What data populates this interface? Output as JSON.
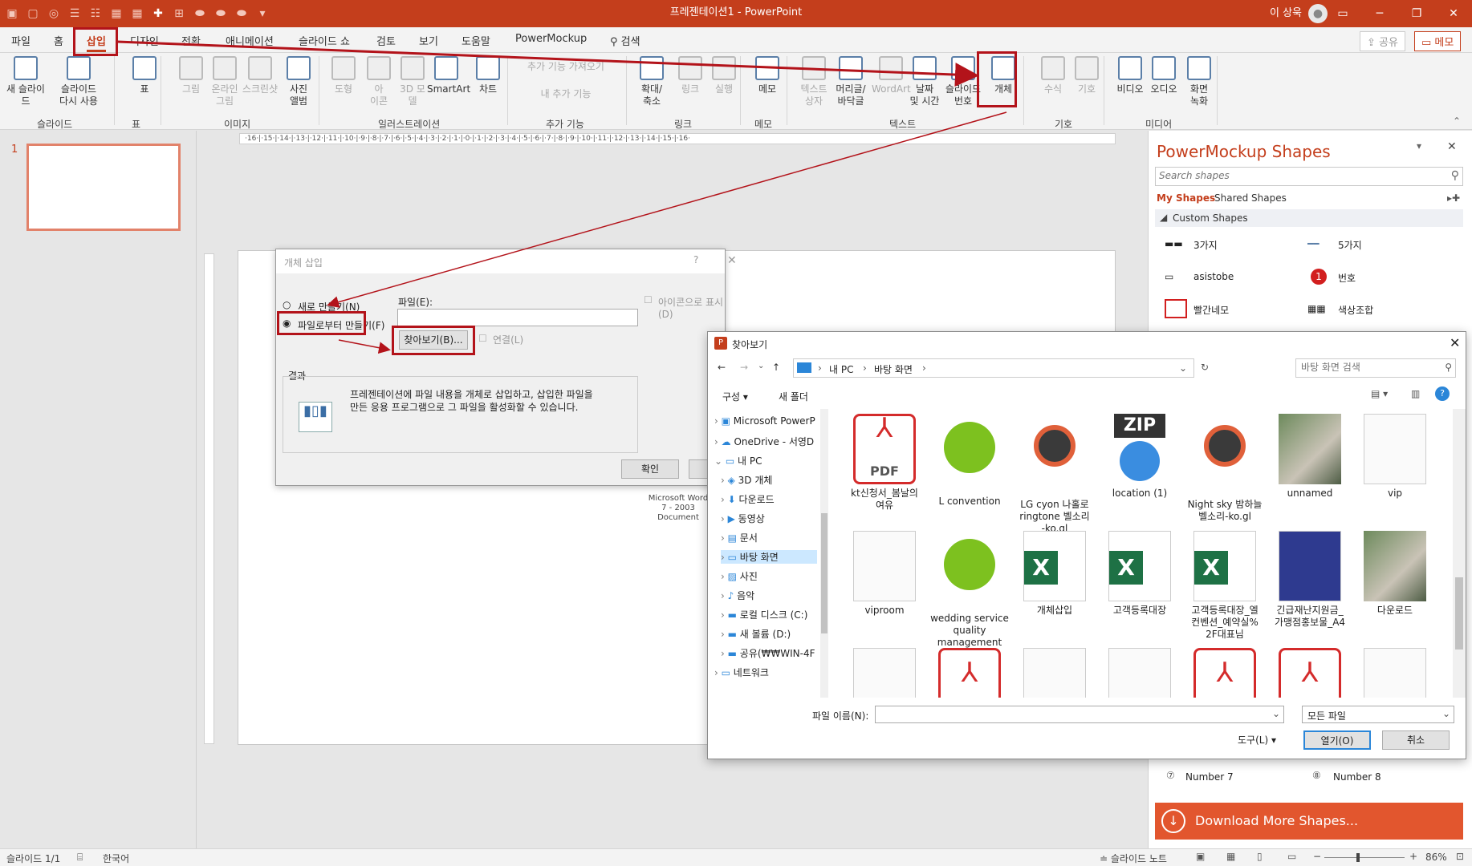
{
  "window": {
    "title": "프레젠테이션1  -  PowerPoint",
    "user": "이 상욱"
  },
  "tabs": [
    "파일",
    "홈",
    "삽입",
    "디자인",
    "전환",
    "애니메이션",
    "슬라이드 쇼",
    "검토",
    "보기",
    "도움말",
    "PowerMockup"
  ],
  "search_label": "검색",
  "share_label": "공유",
  "memo_label": "메모",
  "ribbon": {
    "buttons": [
      {
        "label": "새 슬라이드",
        "dim": false
      },
      {
        "label": "슬라이드\n다시 사용",
        "dim": false
      },
      {
        "label": "표",
        "dim": false
      },
      {
        "label": "그림",
        "dim": true
      },
      {
        "label": "온라인\n그림",
        "dim": true
      },
      {
        "label": "스크린샷",
        "dim": true
      },
      {
        "label": "사진\n앨범",
        "dim": false
      },
      {
        "label": "도형",
        "dim": true
      },
      {
        "label": "아\n이콘",
        "dim": true
      },
      {
        "label": "3D 모\n델",
        "dim": true
      },
      {
        "label": "SmartArt",
        "dim": false
      },
      {
        "label": "차트",
        "dim": false
      },
      {
        "label": "추가 기능 가져오기",
        "dim": true
      },
      {
        "label": "내 추가 기능",
        "dim": true
      },
      {
        "label": "확대/\n축소",
        "dim": false
      },
      {
        "label": "링크",
        "dim": true
      },
      {
        "label": "실행",
        "dim": true
      },
      {
        "label": "메모",
        "dim": false
      },
      {
        "label": "텍스트\n상자",
        "dim": true
      },
      {
        "label": "머리글/\n바닥글",
        "dim": false
      },
      {
        "label": "WordArt",
        "dim": true
      },
      {
        "label": "날짜\n및 시간",
        "dim": false
      },
      {
        "label": "슬라이드\n번호",
        "dim": false
      },
      {
        "label": "개체",
        "dim": false
      },
      {
        "label": "수식",
        "dim": true
      },
      {
        "label": "기호",
        "dim": true
      },
      {
        "label": "비디오",
        "dim": false
      },
      {
        "label": "오디오",
        "dim": false
      },
      {
        "label": "화면\n녹화",
        "dim": false
      }
    ],
    "groups": [
      "슬라이드",
      "표",
      "이미지",
      "일러스트레이션",
      "추가 기능",
      "링크",
      "메모",
      "텍스트",
      "기호",
      "미디어"
    ]
  },
  "slide_number": "1",
  "ruler_text": "·16·|·15·|·14·|·13·|·12·|·11·|·10·|·9·|·8·|·7·|·6·|·5·|·4·|·3·|·2·|·1·|·0·|·1·|·2·|·3·|·4·|·5·|·6·|·7·|·8·|·9·|·10·|·11·|·12·|·13·|·14·|·15·|·16·",
  "object_caption": [
    "Microsoft Word",
    "7 - 2003 Document"
  ],
  "insert_dialog": {
    "title": "개체 삽입",
    "help": "?",
    "create_new": "새로 만들기(N)",
    "create_from_file": "파일로부터 만들기(F)",
    "file_label": "파일(E):",
    "browse": "찾아보기(B)...",
    "link": "연결(L)",
    "display_icon": "아이콘으로 표시(D)",
    "result_label": "결과",
    "result_text": "프레젠테이션에 파일 내용을 개체로 삽입하고, 삽입한 파일을\n만든 응용 프로그램으로 그 파일을 활성화할 수 있습니다.",
    "ok": "확인"
  },
  "browse_dialog": {
    "title": "찾아보기",
    "path": [
      "내 PC",
      "바탕 화면"
    ],
    "search_placeholder": "바탕 화면 검색",
    "organize": "구성",
    "new_folder": "새 폴더",
    "tree": [
      "Microsoft PowerP",
      "OneDrive - 서영D",
      "내 PC",
      "3D 개체",
      "다운로드",
      "동영상",
      "문서",
      "바탕 화면",
      "사진",
      "음악",
      "로컬 디스크 (C:)",
      "새 볼륨 (D:)",
      "공유(₩₩WIN-4F",
      "네트워크"
    ],
    "files": [
      {
        "name": "kt신청서_봄날의\n여유",
        "kind": "pdf"
      },
      {
        "name": "L convention",
        "kind": "green"
      },
      {
        "name": "LG cyon 나홀로\nringtone 벨소리\n-ko.gl",
        "kind": "disc"
      },
      {
        "name": "location (1)",
        "kind": "zip"
      },
      {
        "name": "Night sky 밤하늘\n벨소리-ko.gl",
        "kind": "disc"
      },
      {
        "name": "unnamed",
        "kind": "photo"
      },
      {
        "name": "vip",
        "kind": "doc"
      },
      {
        "name": "viproom",
        "kind": "doc"
      },
      {
        "name": "wedding service\nquality\nmanagement",
        "kind": "green"
      },
      {
        "name": "개체삽입",
        "kind": "xls"
      },
      {
        "name": "고객등록대장",
        "kind": "xls"
      },
      {
        "name": "고객등록대장_엘\n컨벤션_예약실%\n2F대표님",
        "kind": "xls"
      },
      {
        "name": "긴급재난지원금_\n가맹점홍보물_A4",
        "kind": "poster"
      },
      {
        "name": "다운로드",
        "kind": "photo"
      }
    ],
    "filename_label": "파일 이름(N):",
    "filter": "모든 파일",
    "tools": "도구(L)",
    "open": "열기(O)",
    "cancel": "취소"
  },
  "panel": {
    "title": "PowerMockup Shapes",
    "search_placeholder": "Search shapes",
    "my_shapes": "My Shapes",
    "shared_shapes": "Shared Shapes",
    "section": "Custom Shapes",
    "items": [
      "3가지",
      "5가지",
      "asistobe",
      "번호",
      "빨간네모",
      "색상조합",
      "Number 7",
      "Number 8"
    ],
    "download": "Download More Shapes..."
  },
  "status": {
    "slide": "슬라이드 1/1",
    "language": "한국어",
    "notes": "슬라이드 노트",
    "zoom": "86%"
  }
}
